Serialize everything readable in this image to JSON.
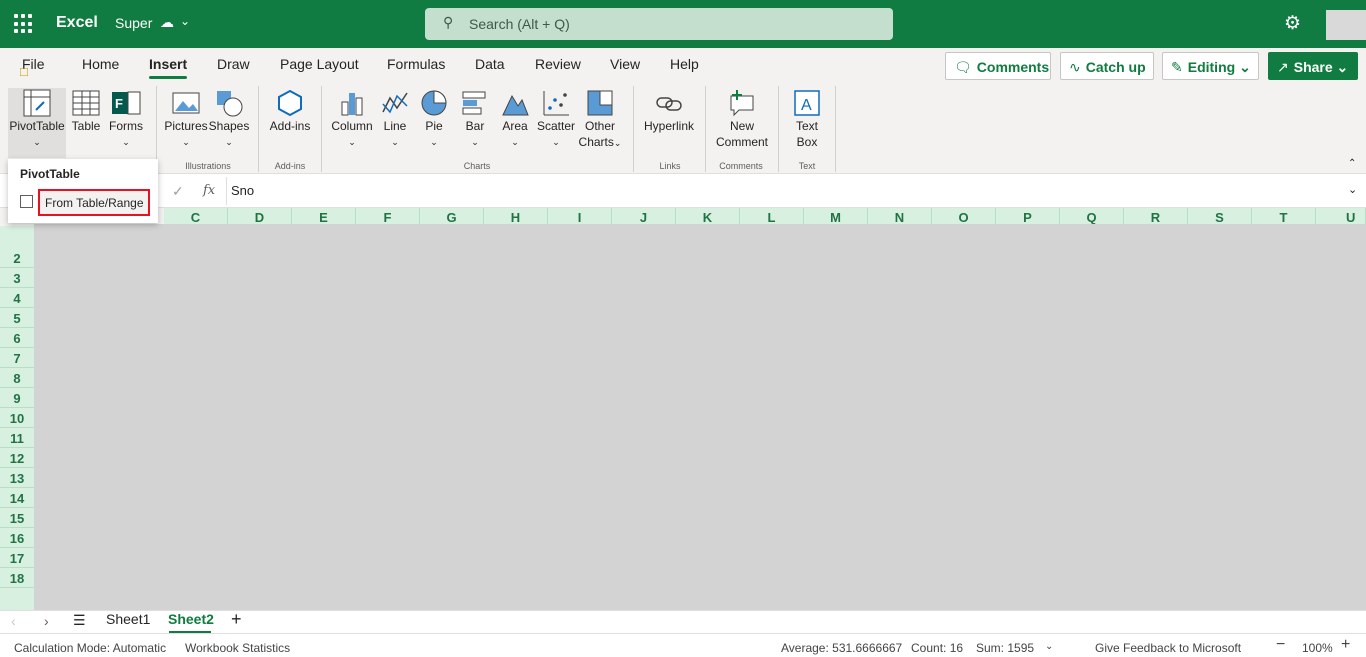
{
  "titlebar": {
    "app_name": "Excel",
    "doc_name": "Super",
    "search_placeholder": "Search (Alt + Q)",
    "color": "#107c41"
  },
  "tabs": [
    "File",
    "Home",
    "Insert",
    "Draw",
    "Page Layout",
    "Formulas",
    "Data",
    "Review",
    "View",
    "Help"
  ],
  "active_tab": "Insert",
  "header_buttons": {
    "comments": "Comments",
    "catch_up": "Catch up",
    "editing": "Editing",
    "share": "Share"
  },
  "ribbon": {
    "pivottable": "PivotTable",
    "table": "Table",
    "forms": "Forms",
    "pictures": "Pictures",
    "shapes": "Shapes",
    "illustrations_group": "Illustrations",
    "addins": "Add-ins",
    "addins_group": "Add-ins",
    "column": "Column",
    "line": "Line",
    "pie": "Pie",
    "bar": "Bar",
    "area": "Area",
    "scatter": "Scatter",
    "other_line1": "Other",
    "other_line2": "Charts",
    "charts_group": "Charts",
    "hyperlink": "Hyperlink",
    "links_group": "Links",
    "new_comment_line1": "New",
    "new_comment_line2": "Comment",
    "comments_group": "Comments",
    "textbox_line1": "Text",
    "textbox_line2": "Box",
    "text_group": "Text"
  },
  "pivot_dropdown": {
    "header": "PivotTable",
    "item": "From Table/Range"
  },
  "formula_bar": {
    "fx": "fx",
    "value": "Sno"
  },
  "columns": [
    "C",
    "D",
    "E",
    "F",
    "G",
    "H",
    "I",
    "J",
    "K",
    "L",
    "M",
    "N",
    "O",
    "P",
    "Q",
    "R",
    "S",
    "T",
    "U"
  ],
  "rows": [
    "2",
    "3",
    "4",
    "5",
    "6",
    "7",
    "8",
    "9",
    "10",
    "11",
    "12",
    "13",
    "14",
    "15",
    "16",
    "17",
    "18"
  ],
  "sheets": [
    "Sheet1",
    "Sheet2"
  ],
  "active_sheet": "Sheet2",
  "status": {
    "calc_mode": "Calculation Mode: Automatic",
    "workbook_stats": "Workbook Statistics",
    "average": "Average: 531.6666667",
    "count": "Count: 16",
    "sum": "Sum: 1595",
    "feedback": "Give Feedback to Microsoft",
    "zoom": "100%"
  }
}
